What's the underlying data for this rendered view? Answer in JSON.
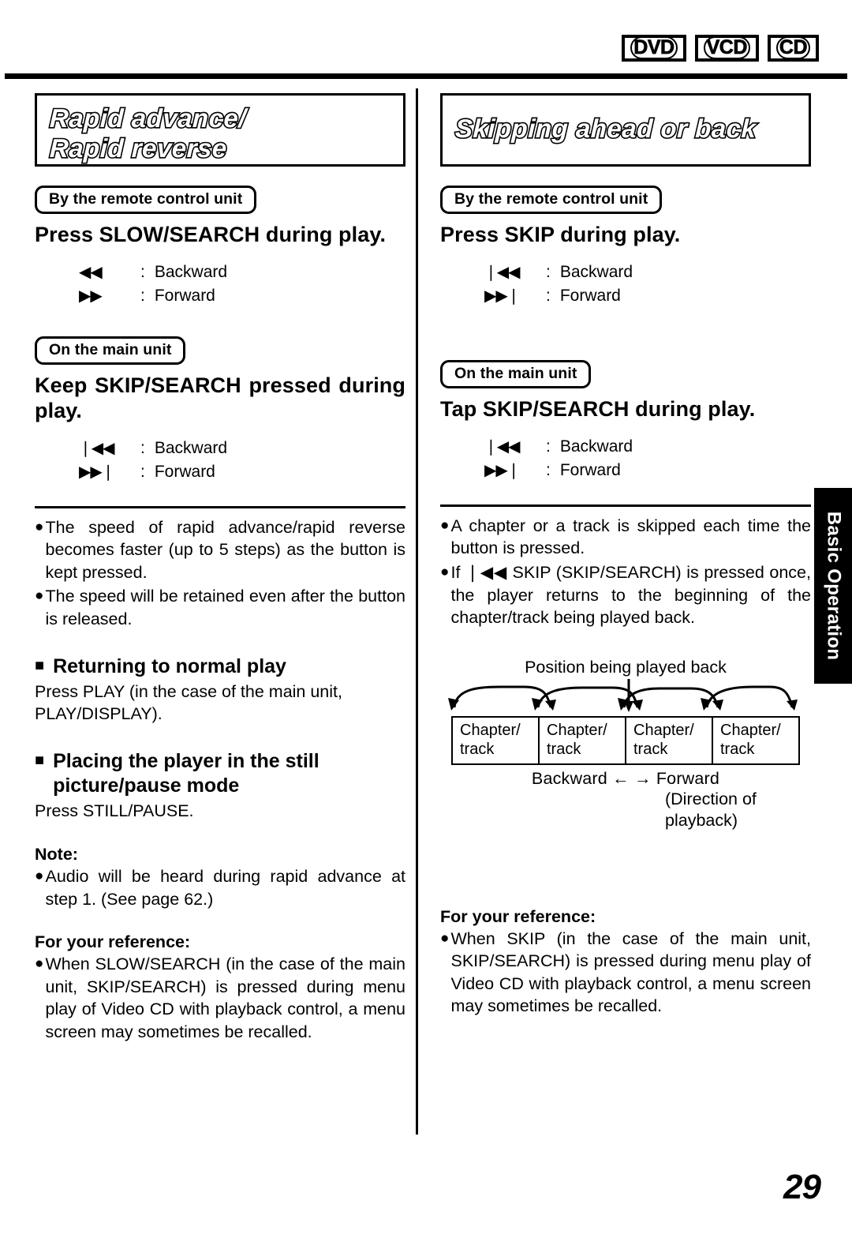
{
  "media_badges": [
    {
      "label": "DVD"
    },
    {
      "label": "VCD"
    },
    {
      "label": "CD"
    }
  ],
  "side_tab": {
    "label": "Basic Operation"
  },
  "page_number": "29",
  "left_column": {
    "banner": {
      "line1": "Rapid advance/",
      "line2": "Rapid reverse"
    },
    "remote_pill": "By the remote control unit",
    "remote_instruction": "Press SLOW/SEARCH during play.",
    "remote_legend": [
      {
        "symbol": "◀◀",
        "colon": ":",
        "label": "Backward"
      },
      {
        "symbol": "▶▶",
        "colon": ":",
        "label": "Forward"
      }
    ],
    "main_pill": "On the main unit",
    "main_instruction": "Keep SKIP/SEARCH pressed during play.",
    "main_legend": [
      {
        "symbol": "❘◀◀",
        "colon": ":",
        "label": "Backward"
      },
      {
        "symbol": "▶▶❘",
        "colon": ":",
        "label": "Forward"
      }
    ],
    "bullets": [
      "The speed of rapid advance/rapid reverse becomes faster (up to 5 steps) as the button is kept pressed.",
      "The speed will be retained even after the button is released."
    ],
    "section1_heading": "Returning to normal play",
    "section1_body": "Press PLAY (in the case of the main unit, PLAY/DISPLAY).",
    "section2_heading": "Placing the player in the still picture/pause mode",
    "section2_body": "Press STILL/PAUSE.",
    "note_label": "Note:",
    "note_bullets": [
      "Audio will be heard during rapid advance at step 1. (See page 62.)"
    ],
    "reference_label": "For your reference:",
    "reference_bullets": [
      "When SLOW/SEARCH (in the case of the main unit, SKIP/SEARCH) is pressed during menu play of Video CD with playback control, a menu screen may sometimes be recalled."
    ]
  },
  "right_column": {
    "banner": {
      "line1": "Skipping ahead or back"
    },
    "remote_pill": "By the remote control unit",
    "remote_instruction": "Press SKIP during play.",
    "remote_legend": [
      {
        "symbol": "❘◀◀",
        "colon": ":",
        "label": "Backward"
      },
      {
        "symbol": "▶▶❘",
        "colon": ":",
        "label": "Forward"
      }
    ],
    "main_pill": "On the main unit",
    "main_instruction": "Tap SKIP/SEARCH during play.",
    "main_legend": [
      {
        "symbol": "❘◀◀",
        "colon": ":",
        "label": "Backward"
      },
      {
        "symbol": "▶▶❘",
        "colon": ":",
        "label": "Forward"
      }
    ],
    "bullets": [
      "A chapter or a track is skipped each time the button is pressed.",
      "If ❘◀◀ SKIP (SKIP/SEARCH) is pressed once, the player returns to the beginning of the chapter/track being played back."
    ],
    "diagram": {
      "caption": "Position being played back",
      "cells": [
        {
          "line1": "Chapter/",
          "line2": "track"
        },
        {
          "line1": "Chapter/",
          "line2": "track"
        },
        {
          "line1": "Chapter/",
          "line2": "track"
        },
        {
          "line1": "Chapter/",
          "line2": "track"
        }
      ],
      "direction_line": "Backward ←   → Forward",
      "direction_sub_line1": "(Direction of",
      "direction_sub_line2": "playback)"
    },
    "reference_label": "For your reference:",
    "reference_bullets": [
      "When SKIP (in the case of the main unit, SKIP/SEARCH) is pressed during menu play of Video CD with playback control, a menu screen may sometimes be recalled."
    ]
  }
}
